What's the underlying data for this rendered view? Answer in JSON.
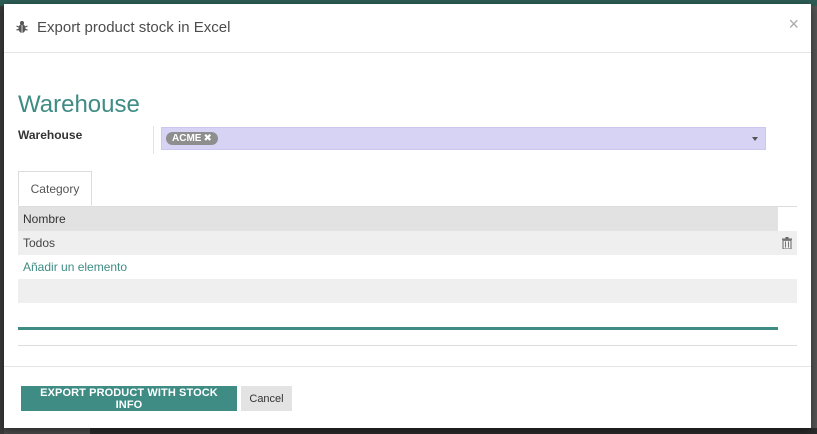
{
  "dialog": {
    "title": "Export product stock in Excel",
    "close_symbol": "×"
  },
  "form": {
    "sheet_title": "Warehouse",
    "warehouse_label": "Warehouse",
    "warehouse_tags": [
      "ACME"
    ],
    "tag_remove_symbol": "✖"
  },
  "tabs": [
    {
      "label": "Category"
    }
  ],
  "table": {
    "columns": [
      "Nombre"
    ],
    "rows": [
      {
        "nombre": "Todos"
      }
    ],
    "add_line_label": "Añadir un elemento"
  },
  "footer": {
    "export_label": "EXPORT PRODUCT WITH STOCK INFO",
    "cancel_label": "Cancel"
  },
  "colors": {
    "accent": "#3e8c84",
    "select_background": "#d6d3f5"
  },
  "icons": [
    "bug-icon",
    "close-icon",
    "trash-icon",
    "chevron-down-icon"
  ]
}
